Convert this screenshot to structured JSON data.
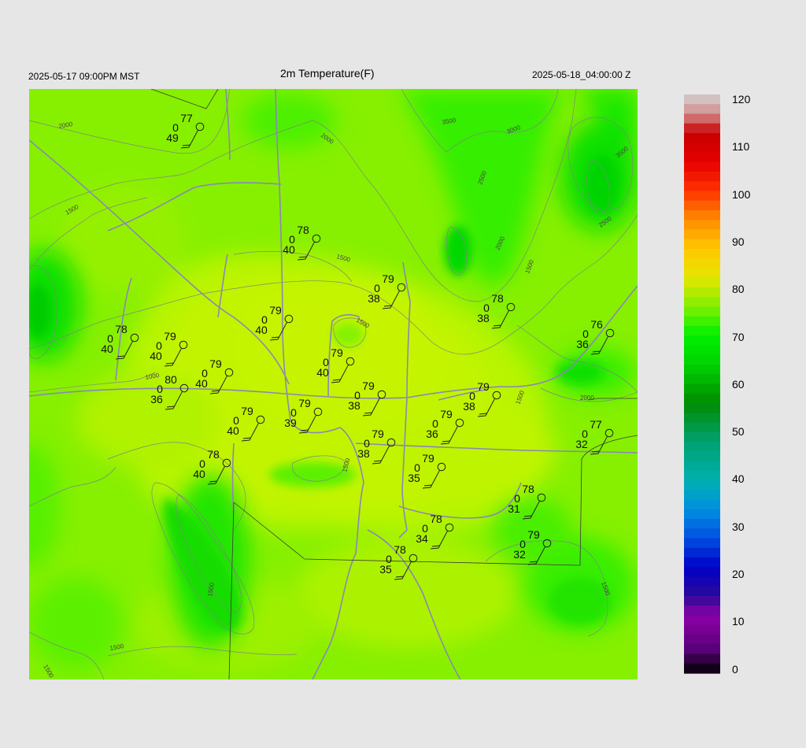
{
  "header": {
    "left_time": "2025-05-17 09:00PM MST",
    "title": "2m Temperature(F)",
    "right_time": "2025-05-18_04:00:00 Z"
  },
  "colorbar": {
    "ticks": [
      "120",
      "110",
      "100",
      "90",
      "80",
      "70",
      "60",
      "50",
      "40",
      "30",
      "20",
      "10",
      "0"
    ],
    "min": 0,
    "max": 120,
    "stops": [
      {
        "v": 0,
        "c": "#000000"
      },
      {
        "v": 5,
        "c": "#5a007a"
      },
      {
        "v": 12,
        "c": "#8c00a6"
      },
      {
        "v": 16,
        "c": "#2a0a9a"
      },
      {
        "v": 22,
        "c": "#0000c8"
      },
      {
        "v": 28,
        "c": "#0050e0"
      },
      {
        "v": 34,
        "c": "#0090e0"
      },
      {
        "v": 40,
        "c": "#00b0b0"
      },
      {
        "v": 48,
        "c": "#00a070"
      },
      {
        "v": 56,
        "c": "#008c00"
      },
      {
        "v": 64,
        "c": "#00d200"
      },
      {
        "v": 70,
        "c": "#00f000"
      },
      {
        "v": 76,
        "c": "#80f000"
      },
      {
        "v": 82,
        "c": "#e6e600"
      },
      {
        "v": 88,
        "c": "#ffc800"
      },
      {
        "v": 94,
        "c": "#ff8c00"
      },
      {
        "v": 100,
        "c": "#ff3200"
      },
      {
        "v": 106,
        "c": "#e60000"
      },
      {
        "v": 112,
        "c": "#c80000"
      },
      {
        "v": 116,
        "c": "#d28c8c"
      },
      {
        "v": 120,
        "c": "#d2d2d2"
      }
    ]
  },
  "stations": [
    {
      "temp": "77",
      "zero": "0",
      "dew": "49"
    },
    {
      "temp": "78",
      "zero": "0",
      "dew": "40"
    },
    {
      "temp": "79",
      "zero": "0",
      "dew": "38"
    },
    {
      "temp": "78",
      "zero": "0",
      "dew": "38"
    },
    {
      "temp": "76",
      "zero": "0",
      "dew": "36"
    },
    {
      "temp": "78",
      "zero": "0",
      "dew": "40"
    },
    {
      "temp": "79",
      "zero": "0",
      "dew": "40"
    },
    {
      "temp": "79",
      "zero": "0",
      "dew": "40"
    },
    {
      "temp": "79",
      "zero": "0",
      "dew": "40"
    },
    {
      "temp": "79",
      "zero": "0",
      "dew": "40"
    },
    {
      "temp": "79",
      "zero": "0",
      "dew": "38"
    },
    {
      "temp": "79",
      "zero": "0",
      "dew": "38"
    },
    {
      "temp": "80",
      "zero": "0",
      "dew": "36"
    },
    {
      "temp": "79",
      "zero": "0",
      "dew": "40"
    },
    {
      "temp": "79",
      "zero": "0",
      "dew": "39"
    },
    {
      "temp": "79",
      "zero": "0",
      "dew": "36"
    },
    {
      "temp": "77",
      "zero": "0",
      "dew": "32"
    },
    {
      "temp": "79",
      "zero": "0",
      "dew": "38"
    },
    {
      "temp": "78",
      "zero": "0",
      "dew": "40"
    },
    {
      "temp": "79",
      "zero": "0",
      "dew": "35"
    },
    {
      "temp": "78",
      "zero": "0",
      "dew": "31"
    },
    {
      "temp": "78",
      "zero": "0",
      "dew": "34"
    },
    {
      "temp": "79",
      "zero": "0",
      "dew": "32"
    },
    {
      "temp": "78",
      "zero": "0",
      "dew": "35"
    }
  ],
  "contour_labels": [
    "2000",
    "2000",
    "3500",
    "3000",
    "3500",
    "2500",
    "2500",
    "2000",
    "1500",
    "1500",
    "1500",
    "1500",
    "1000",
    "1500",
    "2000",
    "1500",
    "1500",
    "1500",
    "1500",
    "1500"
  ]
}
